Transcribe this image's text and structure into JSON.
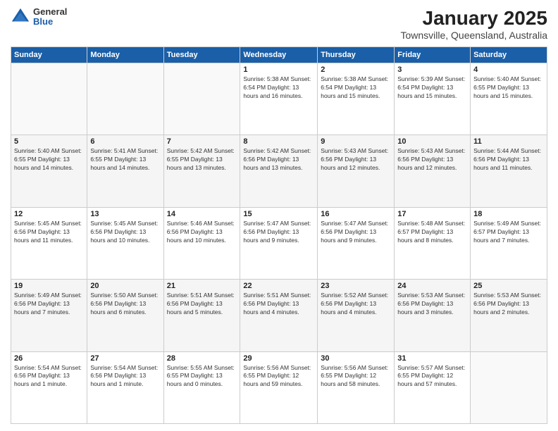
{
  "logo": {
    "general": "General",
    "blue": "Blue"
  },
  "title": "January 2025",
  "subtitle": "Townsville, Queensland, Australia",
  "days_header": [
    "Sunday",
    "Monday",
    "Tuesday",
    "Wednesday",
    "Thursday",
    "Friday",
    "Saturday"
  ],
  "weeks": [
    [
      {
        "num": "",
        "info": ""
      },
      {
        "num": "",
        "info": ""
      },
      {
        "num": "",
        "info": ""
      },
      {
        "num": "1",
        "info": "Sunrise: 5:38 AM\nSunset: 6:54 PM\nDaylight: 13 hours\nand 16 minutes."
      },
      {
        "num": "2",
        "info": "Sunrise: 5:38 AM\nSunset: 6:54 PM\nDaylight: 13 hours\nand 15 minutes."
      },
      {
        "num": "3",
        "info": "Sunrise: 5:39 AM\nSunset: 6:54 PM\nDaylight: 13 hours\nand 15 minutes."
      },
      {
        "num": "4",
        "info": "Sunrise: 5:40 AM\nSunset: 6:55 PM\nDaylight: 13 hours\nand 15 minutes."
      }
    ],
    [
      {
        "num": "5",
        "info": "Sunrise: 5:40 AM\nSunset: 6:55 PM\nDaylight: 13 hours\nand 14 minutes."
      },
      {
        "num": "6",
        "info": "Sunrise: 5:41 AM\nSunset: 6:55 PM\nDaylight: 13 hours\nand 14 minutes."
      },
      {
        "num": "7",
        "info": "Sunrise: 5:42 AM\nSunset: 6:55 PM\nDaylight: 13 hours\nand 13 minutes."
      },
      {
        "num": "8",
        "info": "Sunrise: 5:42 AM\nSunset: 6:56 PM\nDaylight: 13 hours\nand 13 minutes."
      },
      {
        "num": "9",
        "info": "Sunrise: 5:43 AM\nSunset: 6:56 PM\nDaylight: 13 hours\nand 12 minutes."
      },
      {
        "num": "10",
        "info": "Sunrise: 5:43 AM\nSunset: 6:56 PM\nDaylight: 13 hours\nand 12 minutes."
      },
      {
        "num": "11",
        "info": "Sunrise: 5:44 AM\nSunset: 6:56 PM\nDaylight: 13 hours\nand 11 minutes."
      }
    ],
    [
      {
        "num": "12",
        "info": "Sunrise: 5:45 AM\nSunset: 6:56 PM\nDaylight: 13 hours\nand 11 minutes."
      },
      {
        "num": "13",
        "info": "Sunrise: 5:45 AM\nSunset: 6:56 PM\nDaylight: 13 hours\nand 10 minutes."
      },
      {
        "num": "14",
        "info": "Sunrise: 5:46 AM\nSunset: 6:56 PM\nDaylight: 13 hours\nand 10 minutes."
      },
      {
        "num": "15",
        "info": "Sunrise: 5:47 AM\nSunset: 6:56 PM\nDaylight: 13 hours\nand 9 minutes."
      },
      {
        "num": "16",
        "info": "Sunrise: 5:47 AM\nSunset: 6:56 PM\nDaylight: 13 hours\nand 9 minutes."
      },
      {
        "num": "17",
        "info": "Sunrise: 5:48 AM\nSunset: 6:57 PM\nDaylight: 13 hours\nand 8 minutes."
      },
      {
        "num": "18",
        "info": "Sunrise: 5:49 AM\nSunset: 6:57 PM\nDaylight: 13 hours\nand 7 minutes."
      }
    ],
    [
      {
        "num": "19",
        "info": "Sunrise: 5:49 AM\nSunset: 6:56 PM\nDaylight: 13 hours\nand 7 minutes."
      },
      {
        "num": "20",
        "info": "Sunrise: 5:50 AM\nSunset: 6:56 PM\nDaylight: 13 hours\nand 6 minutes."
      },
      {
        "num": "21",
        "info": "Sunrise: 5:51 AM\nSunset: 6:56 PM\nDaylight: 13 hours\nand 5 minutes."
      },
      {
        "num": "22",
        "info": "Sunrise: 5:51 AM\nSunset: 6:56 PM\nDaylight: 13 hours\nand 4 minutes."
      },
      {
        "num": "23",
        "info": "Sunrise: 5:52 AM\nSunset: 6:56 PM\nDaylight: 13 hours\nand 4 minutes."
      },
      {
        "num": "24",
        "info": "Sunrise: 5:53 AM\nSunset: 6:56 PM\nDaylight: 13 hours\nand 3 minutes."
      },
      {
        "num": "25",
        "info": "Sunrise: 5:53 AM\nSunset: 6:56 PM\nDaylight: 13 hours\nand 2 minutes."
      }
    ],
    [
      {
        "num": "26",
        "info": "Sunrise: 5:54 AM\nSunset: 6:56 PM\nDaylight: 13 hours\nand 1 minute."
      },
      {
        "num": "27",
        "info": "Sunrise: 5:54 AM\nSunset: 6:56 PM\nDaylight: 13 hours\nand 1 minute."
      },
      {
        "num": "28",
        "info": "Sunrise: 5:55 AM\nSunset: 6:55 PM\nDaylight: 13 hours\nand 0 minutes."
      },
      {
        "num": "29",
        "info": "Sunrise: 5:56 AM\nSunset: 6:55 PM\nDaylight: 12 hours\nand 59 minutes."
      },
      {
        "num": "30",
        "info": "Sunrise: 5:56 AM\nSunset: 6:55 PM\nDaylight: 12 hours\nand 58 minutes."
      },
      {
        "num": "31",
        "info": "Sunrise: 5:57 AM\nSunset: 6:55 PM\nDaylight: 12 hours\nand 57 minutes."
      },
      {
        "num": "",
        "info": ""
      }
    ]
  ]
}
